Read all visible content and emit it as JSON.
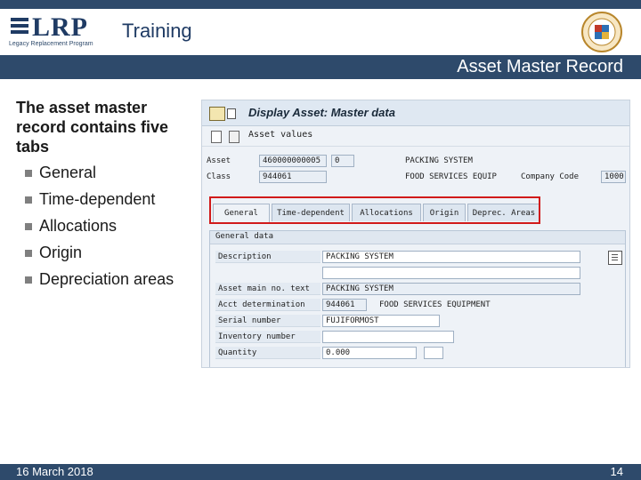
{
  "header": {
    "logo_text": "LRP",
    "logo_subtitle": "Legacy Replacement Program",
    "section": "Training",
    "slide_title": "Asset Master Record"
  },
  "content": {
    "heading": "The asset master record contains five tabs",
    "bullets": [
      "General",
      "Time-dependent",
      "Allocations",
      "Origin",
      "Depreciation areas"
    ]
  },
  "sap": {
    "window_title": "Display Asset:  Master data",
    "toolbar_label": "Asset values",
    "asset_label": "Asset",
    "asset_value": "460000000005",
    "asset_sub": "0",
    "asset_desc": "PACKING SYSTEM",
    "class_label": "Class",
    "class_value": "944061",
    "class_desc": "FOOD SERVICES EQUIP",
    "company_label": "Company Code",
    "company_value": "1000",
    "tabs": [
      "General",
      "Time-dependent",
      "Allocations",
      "Origin",
      "Deprec. Areas"
    ],
    "group_title": "General data",
    "fields": {
      "description_label": "Description",
      "description_value": "PACKING SYSTEM",
      "main_text_label": "Asset main no. text",
      "main_text_value": "PACKING SYSTEM",
      "acct_label": "Acct determination",
      "acct_value": "944061",
      "acct_desc": "FOOD SERVICES EQUIPMENT",
      "serial_label": "Serial number",
      "serial_value": "FUJIFORMOST",
      "inventory_label": "Inventory number",
      "inventory_value": "",
      "quantity_label": "Quantity",
      "quantity_value": "0.000"
    }
  },
  "footer": {
    "date": "16 March 2018",
    "page": "14"
  },
  "colors": {
    "brand": "#2e4a6b",
    "highlight": "#d11a1a"
  }
}
